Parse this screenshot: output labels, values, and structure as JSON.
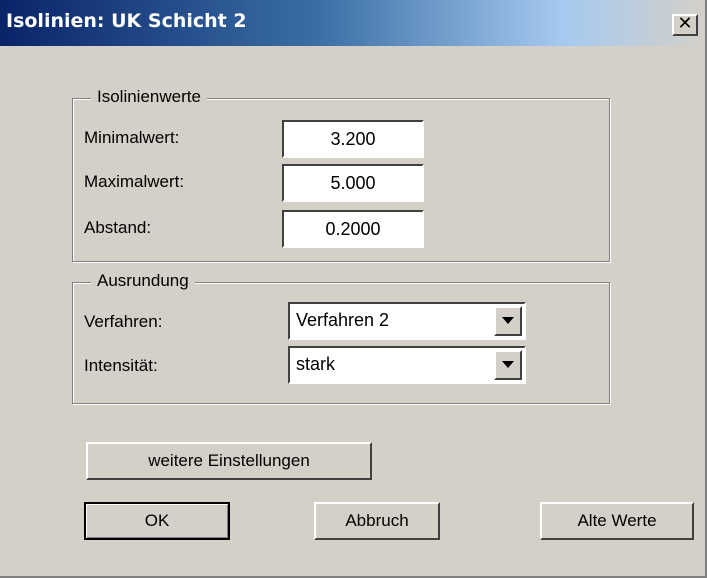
{
  "window": {
    "title": "Isolinien: UK Schicht 2",
    "close_glyph": "✕"
  },
  "isolinienwerte": {
    "legend": "Isolinienwerte",
    "fields": [
      {
        "label": "Minimalwert:",
        "value": "3.200"
      },
      {
        "label": "Maximalwert:",
        "value": "5.000"
      },
      {
        "label": "Abstand:",
        "value": "0.2000"
      }
    ]
  },
  "ausrundung": {
    "legend": "Ausrundung",
    "verfahren": {
      "label": "Verfahren:",
      "selected": "Verfahren 2"
    },
    "intensitaet": {
      "label": "Intensität:",
      "selected": "stark"
    }
  },
  "buttons": {
    "weitere": "weitere Einstellungen",
    "ok": "OK",
    "abbruch": "Abbruch",
    "alte_werte": "Alte Werte"
  },
  "icons": {
    "close": "close-icon",
    "dropdown": "chevron-down-icon"
  },
  "colors": {
    "titlebar_start": "#0a246a",
    "titlebar_end": "#a6caf0",
    "dialog_bg": "#d4d0c8"
  }
}
